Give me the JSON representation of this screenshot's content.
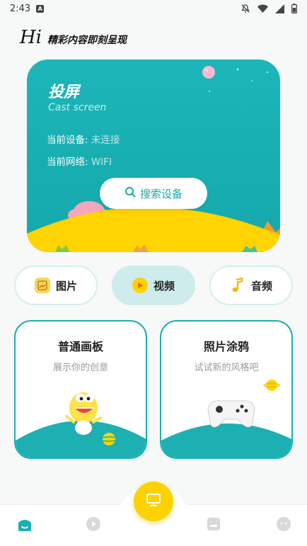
{
  "status_bar": {
    "time": "2:43",
    "badge": "A",
    "icons": [
      "notifications-off-icon",
      "wifi-icon",
      "signal-icon",
      "battery-icon"
    ]
  },
  "greeting": {
    "hi": "Hi",
    "subtitle": "精彩内容即刻呈现"
  },
  "cast": {
    "title": "投屏",
    "subtitle": "Cast screen",
    "device_label": "当前设备: ",
    "device_value": "未连接",
    "network_label": "当前网络: ",
    "network_value": "WIFI",
    "search_button": "搜索设备"
  },
  "media_tabs": [
    {
      "label": "图片",
      "icon": "image-icon",
      "active": false
    },
    {
      "label": "视频",
      "icon": "video-icon",
      "active": true
    },
    {
      "label": "音频",
      "icon": "music-note-icon",
      "active": false
    }
  ],
  "features": [
    {
      "title": "普通画板",
      "subtitle": "展示你的创意"
    },
    {
      "title": "照片涂鸦",
      "subtitle": "试试新的风格吧"
    }
  ],
  "bottom_nav": {
    "items": [
      "home-icon",
      "play-icon",
      "cast-icon",
      "files-icon",
      "profile-icon"
    ]
  },
  "colors": {
    "accent": "#1cb0b2",
    "accent_light": "#cfecec",
    "fab": "#fcd200",
    "hill_yellow": "#ffd400"
  }
}
